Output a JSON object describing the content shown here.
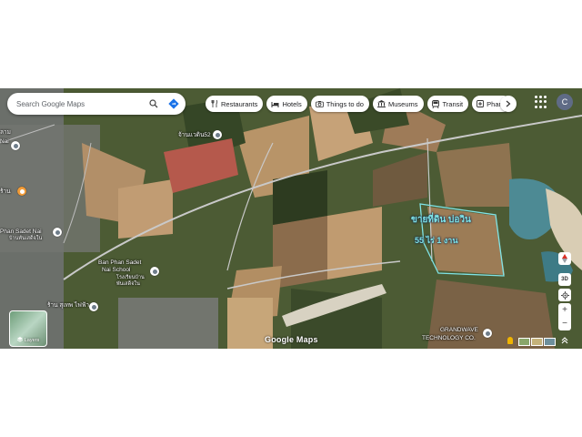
{
  "search": {
    "placeholder": "Search Google Maps",
    "search_icon": "search-icon",
    "directions_icon": "directions-icon"
  },
  "chips": [
    {
      "label": "Restaurants",
      "icon": "fork-knife-icon"
    },
    {
      "label": "Hotels",
      "icon": "bed-icon"
    },
    {
      "label": "Things to do",
      "icon": "camera-icon"
    },
    {
      "label": "Museums",
      "icon": "museum-icon"
    },
    {
      "label": "Transit",
      "icon": "transit-icon"
    },
    {
      "label": "Pharmacies",
      "icon": "pharmacy-icon"
    }
  ],
  "account": {
    "initial": "C"
  },
  "places": {
    "village52": "จ้านแวดิน52",
    "phan_sadet_nai": "Phan Sadet Nai",
    "phan_sadet_nai_thai": "บ้านพันเสด็จใน",
    "school_en_1": "Ban Phan Sadet",
    "school_en_2": "Nai School",
    "school_th_1": "โรงเรียนบ้าน",
    "school_th_2": "พันเสด็จใน",
    "shop_th": "ร้าน สุเทพ ไฟฟ้า",
    "grandwave_1": "GRANDWAVE",
    "grandwave_2": "TECHNOLOGY CO.",
    "left_top_1": "ลาม",
    "left_top_2": "Nai",
    "left_mid": "ร้าน"
  },
  "overlay": {
    "sale_text": "ขายที่ดิน บ่อวิน",
    "area_text": "55 ไร่ 1 งาน"
  },
  "controls": {
    "layers_label": "Layers",
    "zoom_in": "+",
    "zoom_out": "−",
    "label_3d": "3D"
  },
  "branding": {
    "logo": "Google Maps"
  },
  "colors": {
    "parcel_outline": "#7fe3e6",
    "road": "#c9c9c9",
    "avatar_bg": "#5f6b86"
  }
}
